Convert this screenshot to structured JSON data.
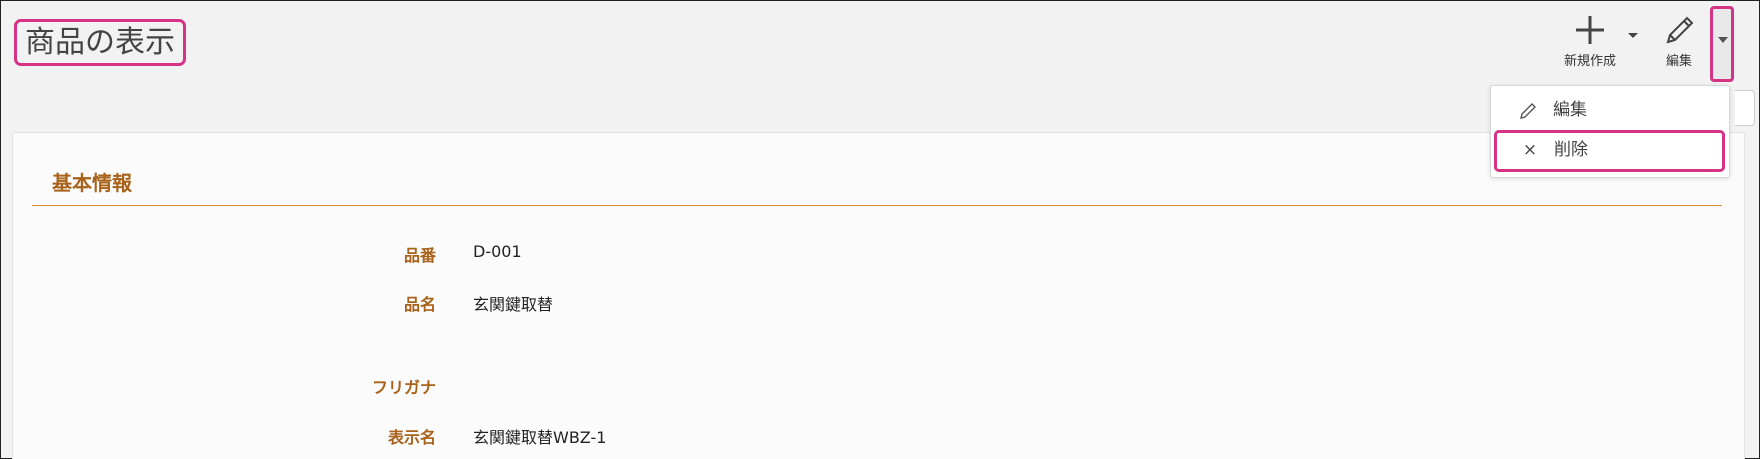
{
  "page": {
    "title": "商品の表示"
  },
  "toolbar": {
    "new_label": "新規作成",
    "edit_label": "編集"
  },
  "dropdown": {
    "edit_label": "編集",
    "delete_label": "削除"
  },
  "section": {
    "title": "基本情報"
  },
  "fields": [
    {
      "label": "品番",
      "value": "D-001"
    },
    {
      "label": "品名",
      "value": "玄関鍵取替"
    },
    {
      "label": "フリガナ",
      "value": ""
    },
    {
      "label": "表示名",
      "value": "玄関鍵取替WBZ-1"
    }
  ],
  "colors": {
    "accent": "#a8621a",
    "highlight": "#d63384",
    "background": "#f2f2f2"
  },
  "icons": {
    "new": "plus-icon",
    "new_menu": "caret-down-icon",
    "edit": "pencil-icon",
    "more": "caret-down-icon",
    "dropdown_edit": "pencil-icon",
    "dropdown_delete": "close-icon"
  }
}
